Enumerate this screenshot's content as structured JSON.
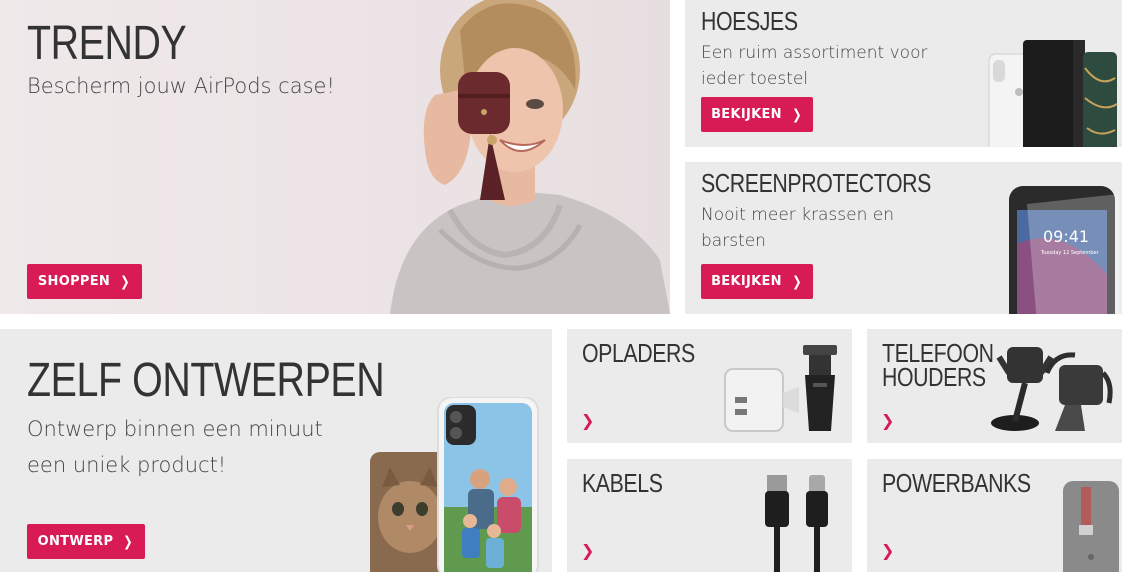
{
  "hero": {
    "title": "TRENDY",
    "subtitle": "Bescherm jouw AirPods case!",
    "button_label": "SHOPPEN"
  },
  "hoesjes": {
    "title": "HOESJES",
    "subtitle": "Een ruim assortiment voor ieder toestel",
    "button_label": "BEKIJKEN"
  },
  "screenprotectors": {
    "title": "SCREENPROTECTORS",
    "subtitle": "Nooit meer krassen en barsten",
    "button_label": "BEKIJKEN",
    "phone_time": "09:41",
    "phone_date": "Tuesday 12 September"
  },
  "zelf_ontwerpen": {
    "title": "ZELF ONTWERPEN",
    "subtitle": "Ontwerp binnen een minuut een uniek product!",
    "button_label": "ONTWERP"
  },
  "categories": {
    "opladers": {
      "title": "OPLADERS"
    },
    "telefoon_houders": {
      "title_line1": "TELEFOON",
      "title_line2": "HOUDERS"
    },
    "kabels": {
      "title": "KABELS"
    },
    "powerbanks": {
      "title": "POWERBANKS"
    }
  },
  "colors": {
    "accent": "#d81b55",
    "tile_background": "#ebebeb",
    "heading_text": "#333333"
  },
  "icons": {
    "button_chevron": "chevron-right-icon"
  }
}
